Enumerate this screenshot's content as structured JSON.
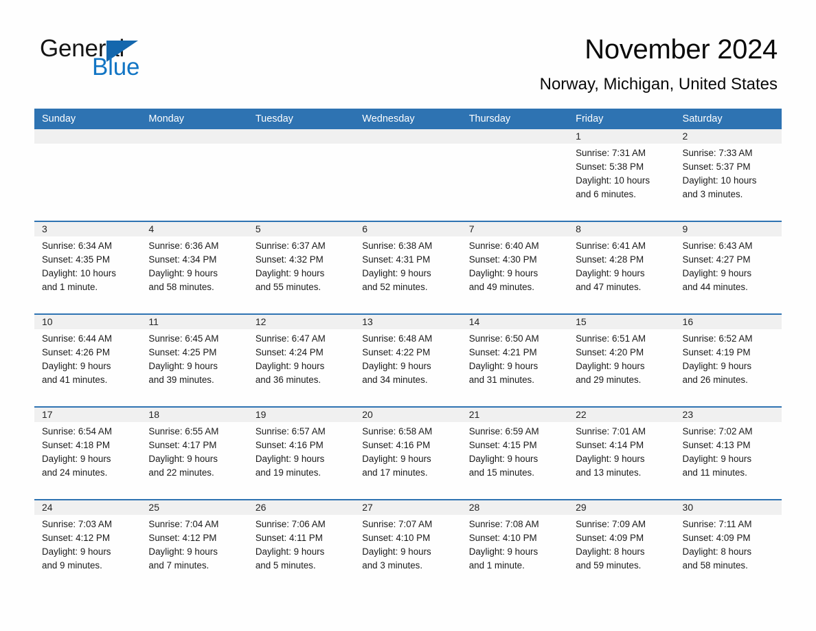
{
  "brand": {
    "name_part1": "General",
    "name_part2": "Blue",
    "triangle_icon": "triangle-right-icon",
    "accent_color": "#1467ad",
    "blue_text_color": "#1275c4"
  },
  "header": {
    "title": "November 2024",
    "location": "Norway, Michigan, United States"
  },
  "theme": {
    "header_blue": "#2e73b2",
    "daynum_band_gray": "#f0f0f0",
    "divider_blue": "#2e73b2",
    "page_background": "#fefefe",
    "text_color": "#1a1a1a"
  },
  "weekday_headers": [
    "Sunday",
    "Monday",
    "Tuesday",
    "Wednesday",
    "Thursday",
    "Friday",
    "Saturday"
  ],
  "weeks": [
    [
      {
        "day": "",
        "empty": true
      },
      {
        "day": "",
        "empty": true
      },
      {
        "day": "",
        "empty": true
      },
      {
        "day": "",
        "empty": true
      },
      {
        "day": "",
        "empty": true
      },
      {
        "day": "1",
        "sunrise": "Sunrise: 7:31 AM",
        "sunset": "Sunset: 5:38 PM",
        "daylight_line1": "Daylight: 10 hours",
        "daylight_line2": "and 6 minutes."
      },
      {
        "day": "2",
        "sunrise": "Sunrise: 7:33 AM",
        "sunset": "Sunset: 5:37 PM",
        "daylight_line1": "Daylight: 10 hours",
        "daylight_line2": "and 3 minutes."
      }
    ],
    [
      {
        "day": "3",
        "sunrise": "Sunrise: 6:34 AM",
        "sunset": "Sunset: 4:35 PM",
        "daylight_line1": "Daylight: 10 hours",
        "daylight_line2": "and 1 minute."
      },
      {
        "day": "4",
        "sunrise": "Sunrise: 6:36 AM",
        "sunset": "Sunset: 4:34 PM",
        "daylight_line1": "Daylight: 9 hours",
        "daylight_line2": "and 58 minutes."
      },
      {
        "day": "5",
        "sunrise": "Sunrise: 6:37 AM",
        "sunset": "Sunset: 4:32 PM",
        "daylight_line1": "Daylight: 9 hours",
        "daylight_line2": "and 55 minutes."
      },
      {
        "day": "6",
        "sunrise": "Sunrise: 6:38 AM",
        "sunset": "Sunset: 4:31 PM",
        "daylight_line1": "Daylight: 9 hours",
        "daylight_line2": "and 52 minutes."
      },
      {
        "day": "7",
        "sunrise": "Sunrise: 6:40 AM",
        "sunset": "Sunset: 4:30 PM",
        "daylight_line1": "Daylight: 9 hours",
        "daylight_line2": "and 49 minutes."
      },
      {
        "day": "8",
        "sunrise": "Sunrise: 6:41 AM",
        "sunset": "Sunset: 4:28 PM",
        "daylight_line1": "Daylight: 9 hours",
        "daylight_line2": "and 47 minutes."
      },
      {
        "day": "9",
        "sunrise": "Sunrise: 6:43 AM",
        "sunset": "Sunset: 4:27 PM",
        "daylight_line1": "Daylight: 9 hours",
        "daylight_line2": "and 44 minutes."
      }
    ],
    [
      {
        "day": "10",
        "sunrise": "Sunrise: 6:44 AM",
        "sunset": "Sunset: 4:26 PM",
        "daylight_line1": "Daylight: 9 hours",
        "daylight_line2": "and 41 minutes."
      },
      {
        "day": "11",
        "sunrise": "Sunrise: 6:45 AM",
        "sunset": "Sunset: 4:25 PM",
        "daylight_line1": "Daylight: 9 hours",
        "daylight_line2": "and 39 minutes."
      },
      {
        "day": "12",
        "sunrise": "Sunrise: 6:47 AM",
        "sunset": "Sunset: 4:24 PM",
        "daylight_line1": "Daylight: 9 hours",
        "daylight_line2": "and 36 minutes."
      },
      {
        "day": "13",
        "sunrise": "Sunrise: 6:48 AM",
        "sunset": "Sunset: 4:22 PM",
        "daylight_line1": "Daylight: 9 hours",
        "daylight_line2": "and 34 minutes."
      },
      {
        "day": "14",
        "sunrise": "Sunrise: 6:50 AM",
        "sunset": "Sunset: 4:21 PM",
        "daylight_line1": "Daylight: 9 hours",
        "daylight_line2": "and 31 minutes."
      },
      {
        "day": "15",
        "sunrise": "Sunrise: 6:51 AM",
        "sunset": "Sunset: 4:20 PM",
        "daylight_line1": "Daylight: 9 hours",
        "daylight_line2": "and 29 minutes."
      },
      {
        "day": "16",
        "sunrise": "Sunrise: 6:52 AM",
        "sunset": "Sunset: 4:19 PM",
        "daylight_line1": "Daylight: 9 hours",
        "daylight_line2": "and 26 minutes."
      }
    ],
    [
      {
        "day": "17",
        "sunrise": "Sunrise: 6:54 AM",
        "sunset": "Sunset: 4:18 PM",
        "daylight_line1": "Daylight: 9 hours",
        "daylight_line2": "and 24 minutes."
      },
      {
        "day": "18",
        "sunrise": "Sunrise: 6:55 AM",
        "sunset": "Sunset: 4:17 PM",
        "daylight_line1": "Daylight: 9 hours",
        "daylight_line2": "and 22 minutes."
      },
      {
        "day": "19",
        "sunrise": "Sunrise: 6:57 AM",
        "sunset": "Sunset: 4:16 PM",
        "daylight_line1": "Daylight: 9 hours",
        "daylight_line2": "and 19 minutes."
      },
      {
        "day": "20",
        "sunrise": "Sunrise: 6:58 AM",
        "sunset": "Sunset: 4:16 PM",
        "daylight_line1": "Daylight: 9 hours",
        "daylight_line2": "and 17 minutes."
      },
      {
        "day": "21",
        "sunrise": "Sunrise: 6:59 AM",
        "sunset": "Sunset: 4:15 PM",
        "daylight_line1": "Daylight: 9 hours",
        "daylight_line2": "and 15 minutes."
      },
      {
        "day": "22",
        "sunrise": "Sunrise: 7:01 AM",
        "sunset": "Sunset: 4:14 PM",
        "daylight_line1": "Daylight: 9 hours",
        "daylight_line2": "and 13 minutes."
      },
      {
        "day": "23",
        "sunrise": "Sunrise: 7:02 AM",
        "sunset": "Sunset: 4:13 PM",
        "daylight_line1": "Daylight: 9 hours",
        "daylight_line2": "and 11 minutes."
      }
    ],
    [
      {
        "day": "24",
        "sunrise": "Sunrise: 7:03 AM",
        "sunset": "Sunset: 4:12 PM",
        "daylight_line1": "Daylight: 9 hours",
        "daylight_line2": "and 9 minutes."
      },
      {
        "day": "25",
        "sunrise": "Sunrise: 7:04 AM",
        "sunset": "Sunset: 4:12 PM",
        "daylight_line1": "Daylight: 9 hours",
        "daylight_line2": "and 7 minutes."
      },
      {
        "day": "26",
        "sunrise": "Sunrise: 7:06 AM",
        "sunset": "Sunset: 4:11 PM",
        "daylight_line1": "Daylight: 9 hours",
        "daylight_line2": "and 5 minutes."
      },
      {
        "day": "27",
        "sunrise": "Sunrise: 7:07 AM",
        "sunset": "Sunset: 4:10 PM",
        "daylight_line1": "Daylight: 9 hours",
        "daylight_line2": "and 3 minutes."
      },
      {
        "day": "28",
        "sunrise": "Sunrise: 7:08 AM",
        "sunset": "Sunset: 4:10 PM",
        "daylight_line1": "Daylight: 9 hours",
        "daylight_line2": "and 1 minute."
      },
      {
        "day": "29",
        "sunrise": "Sunrise: 7:09 AM",
        "sunset": "Sunset: 4:09 PM",
        "daylight_line1": "Daylight: 8 hours",
        "daylight_line2": "and 59 minutes."
      },
      {
        "day": "30",
        "sunrise": "Sunrise: 7:11 AM",
        "sunset": "Sunset: 4:09 PM",
        "daylight_line1": "Daylight: 8 hours",
        "daylight_line2": "and 58 minutes."
      }
    ]
  ]
}
